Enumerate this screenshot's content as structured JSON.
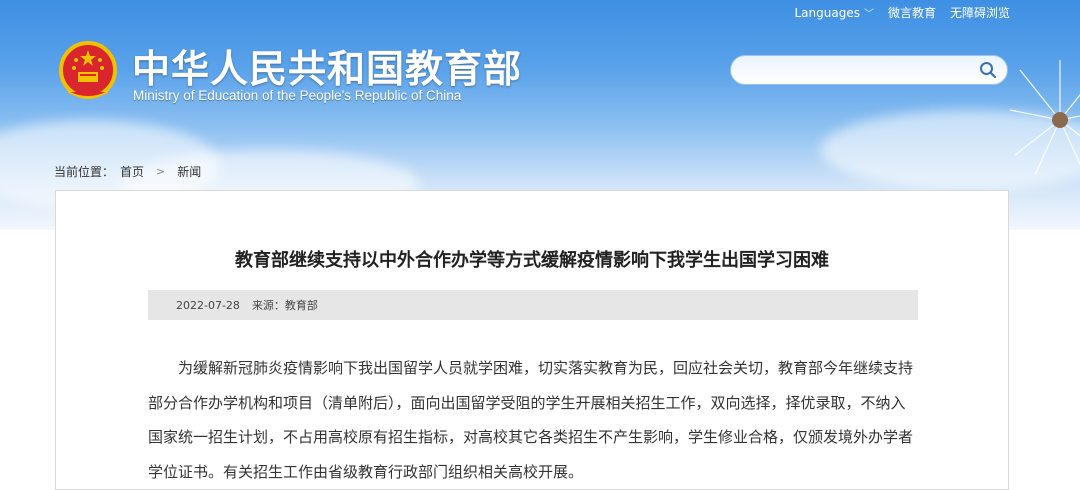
{
  "header": {
    "top_links": {
      "languages": "Languages",
      "weibo": "微言教育",
      "accessible": "无障碍浏览"
    },
    "site_title_cn": "中华人民共和国教育部",
    "site_title_en": "Ministry of Education of the People's Republic of China",
    "search": {
      "placeholder": "",
      "value": ""
    }
  },
  "breadcrumb": {
    "prefix": "当前位置：",
    "home": "首页",
    "current": "新闻"
  },
  "article": {
    "title": "教育部继续支持以中外合作办学等方式缓解疫情影响下我学生出国学习困难",
    "date": "2022-07-28",
    "source": "来源：教育部",
    "body": "为缓解新冠肺炎疫情影响下我出国留学人员就学困难，切实落实教育为民，回应社会关切，教育部今年继续支持部分合作办学机构和项目（清单附后），面向出国留学受阻的学生开展相关招生工作，双向选择，择优录取，不纳入国家统一招生计划，不占用高校原有招生指标，对高校其它各类招生不产生影响，学生修业合格，仅颁发境外办学者学位证书。有关招生工作由省级教育行政部门组织相关高校开展。"
  }
}
